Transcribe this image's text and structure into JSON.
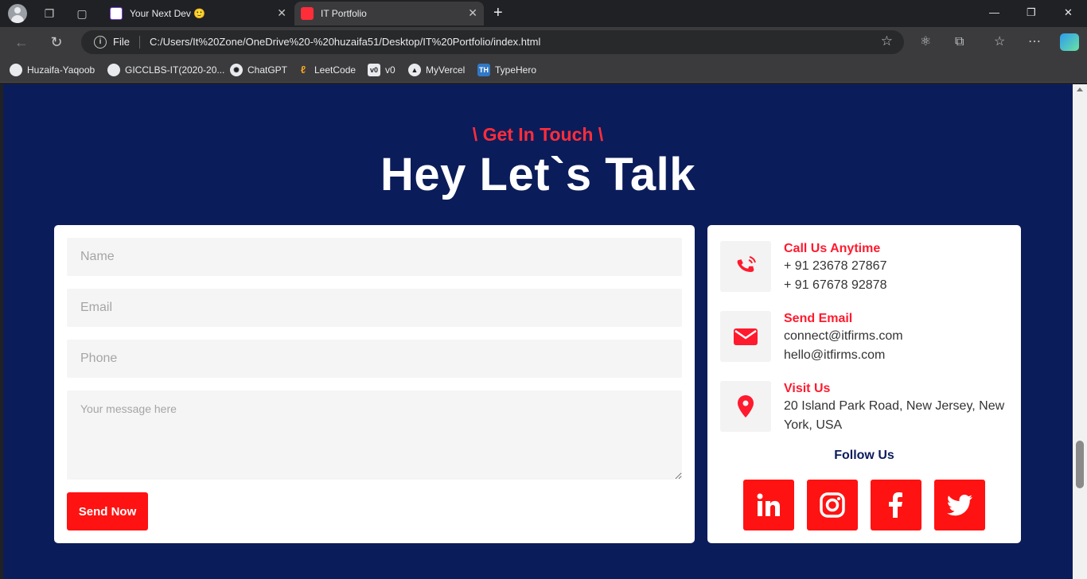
{
  "browser": {
    "tabs": [
      {
        "title": "Your Next Dev 🙂",
        "active": false
      },
      {
        "title": "IT Portfolio",
        "active": true
      }
    ],
    "url_scheme_label": "File",
    "url": "C:/Users/It%20Zone/OneDrive%20-%20huzaifa51/Desktop/IT%20Portfolio/index.html",
    "bookmarks": [
      {
        "label": "Huzaifa-Yaqoob",
        "icon": "github-icon"
      },
      {
        "label": "GICCLBS-IT(2020-20...",
        "icon": "github-icon"
      },
      {
        "label": "ChatGPT",
        "icon": "chatgpt-icon"
      },
      {
        "label": "LeetCode",
        "icon": "leetcode-icon"
      },
      {
        "label": "v0",
        "icon": "v0-icon"
      },
      {
        "label": "MyVercel",
        "icon": "vercel-icon"
      },
      {
        "label": "TypeHero",
        "icon": "typehero-icon"
      }
    ]
  },
  "section": {
    "subtitle": "\\ Get In Touch \\",
    "heading": "Hey Let`s Talk"
  },
  "form": {
    "name_placeholder": "Name",
    "email_placeholder": "Email",
    "phone_placeholder": "Phone",
    "message_placeholder": "Your message here",
    "submit_label": "Send Now"
  },
  "contact": {
    "call": {
      "title": "Call Us Anytime",
      "lines": [
        "+ 91 23678 27867",
        "+ 91 67678 92878"
      ]
    },
    "email": {
      "title": "Send Email",
      "lines": [
        "connect@itfirms.com",
        "hello@itfirms.com"
      ]
    },
    "visit": {
      "title": "Visit Us",
      "lines": [
        "20 Island Park Road, New Jersey, New York, USA"
      ]
    },
    "follow_label": "Follow Us"
  },
  "colors": {
    "page_bg": "#0b1c5a",
    "accent": "#ff1212",
    "card_bg": "#ffffff"
  }
}
